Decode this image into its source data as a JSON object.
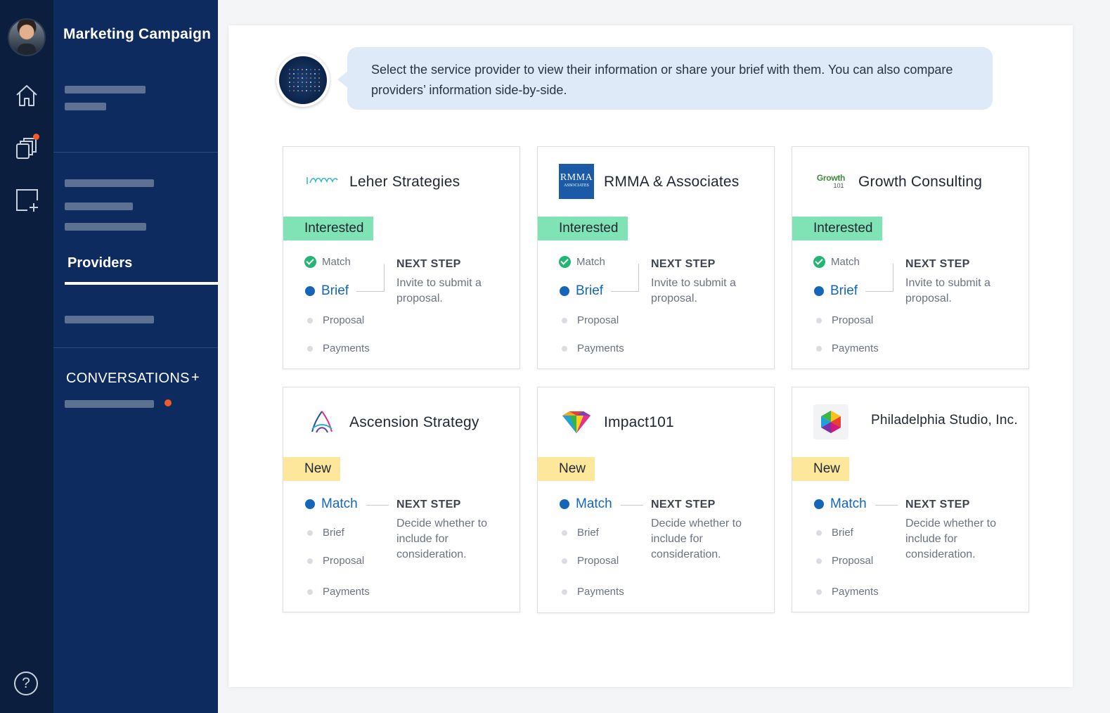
{
  "sidebar": {
    "title": "Marketing Campaign",
    "providers_label": "Providers",
    "conversations_label": "CONVERSATIONS",
    "add_symbol": "+"
  },
  "rail": {
    "icons": [
      "avatar",
      "home-icon",
      "stack-icon",
      "add-box-icon",
      "help-icon"
    ],
    "help_symbol": "?"
  },
  "intro": {
    "message": "Select the service provider to view their information or share your brief with them. You can also compare providers’ information side-by-side."
  },
  "cards": [
    {
      "name": "Leher Strategies",
      "badge": "Interested",
      "steps": [
        "Match",
        "Brief",
        "Proposal",
        "Payments"
      ],
      "next_step_title": "NEXT STEP",
      "next_step_text": "Invite to submit a proposal."
    },
    {
      "name": "RMMA & Associates",
      "logo_text": "RMMA",
      "logo_subtext": "ASSOCIATES",
      "badge": "Interested",
      "steps": [
        "Match",
        "Brief",
        "Proposal",
        "Payments"
      ],
      "next_step_title": "NEXT STEP",
      "next_step_text": "Invite to submit a proposal."
    },
    {
      "name": "Growth Consulting",
      "logo_text": "Growth",
      "logo_subtext": "101",
      "badge": "Interested",
      "steps": [
        "Match",
        "Brief",
        "Proposal",
        "Payments"
      ],
      "next_step_title": "NEXT STEP",
      "next_step_text": "Invite to submit a proposal."
    },
    {
      "name": "Ascension Strategy",
      "badge": "New",
      "steps": [
        "Match",
        "Brief",
        "Proposal",
        "Payments"
      ],
      "next_step_title": "NEXT STEP",
      "next_step_text": "Decide whether to include for consideration."
    },
    {
      "name": "Impact101",
      "badge": "New",
      "steps": [
        "Match",
        "Brief",
        "Proposal",
        "Payments"
      ],
      "next_step_title": "NEXT STEP",
      "next_step_text": "Decide whether to include for consideration."
    },
    {
      "name": "Philadelphia Studio, Inc.",
      "badge": "New",
      "steps": [
        "Match",
        "Brief",
        "Proposal",
        "Payments"
      ],
      "next_step_title": "NEXT STEP",
      "next_step_text": "Decide whether to include for consideration."
    }
  ],
  "colors": {
    "rail": "#0b1e3d",
    "sidebar": "#0d2b5e",
    "interested_badge": "#7fe3b5",
    "new_badge": "#fde79a",
    "active_step": "#1565b8",
    "done_step": "#22b573",
    "notification": "#f15a2b"
  }
}
